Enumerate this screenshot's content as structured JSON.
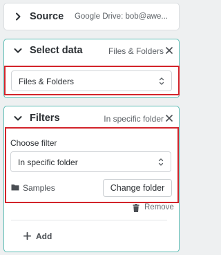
{
  "source_step": {
    "title": "Source",
    "summary": "Google Drive: bob@awe..."
  },
  "select_data_step": {
    "title": "Select data",
    "summary": "Files & Folders",
    "select_value": "Files & Folders"
  },
  "filters_step": {
    "title": "Filters",
    "summary": "In specific folder",
    "choose_filter_label": "Choose filter",
    "filter_select_value": "In specific folder",
    "folder_name": "Samples",
    "change_folder_label": "Change folder",
    "remove_label": "Remove",
    "add_label": "Add"
  },
  "colors": {
    "accent_border": "#5bbcb4",
    "highlight": "#d2232a"
  },
  "icons": [
    "chevron-right-icon",
    "chevron-down-icon",
    "close-icon",
    "select-caret-icon",
    "folder-icon",
    "trash-icon",
    "plus-icon"
  ]
}
